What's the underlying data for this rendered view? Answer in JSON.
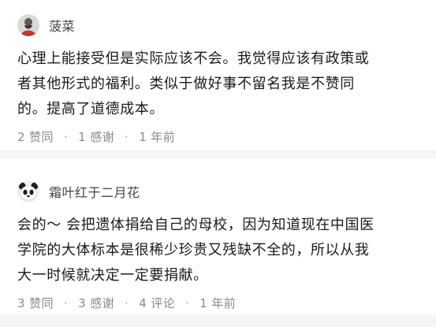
{
  "answers": [
    {
      "author": "菠菜",
      "avatar_icon": "user-avatar-icon",
      "content_lines": [
        "心理上能接受但是实际应该不会。我觉得应该有政策或",
        "者其他形式的福利。类似于做好事不留名我是不赞同",
        "的。提高了道德成本。"
      ],
      "likes": "2 赞同",
      "thanks": "1 感谢",
      "time": "1 年前"
    },
    {
      "author": "霜叶红于二月花",
      "avatar_icon": "panda-avatar-icon",
      "content_lines": [
        "会的～ 会把遗体捐给自己的母校，因为知道现在中国医",
        "学院的大体标本是很稀少珍贵又残缺不全的，所以从我",
        "大一时候就决定一定要捐献。"
      ],
      "likes": "3 赞同",
      "thanks": "3 感谢",
      "comments": "4 评论",
      "time": "1 年前"
    }
  ],
  "separator": "·",
  "colors": {
    "background": "#ffffff",
    "divider": "#f4f5f7",
    "text": "#1a1a1a",
    "meta": "#8a8a8a",
    "author": "#444444"
  }
}
